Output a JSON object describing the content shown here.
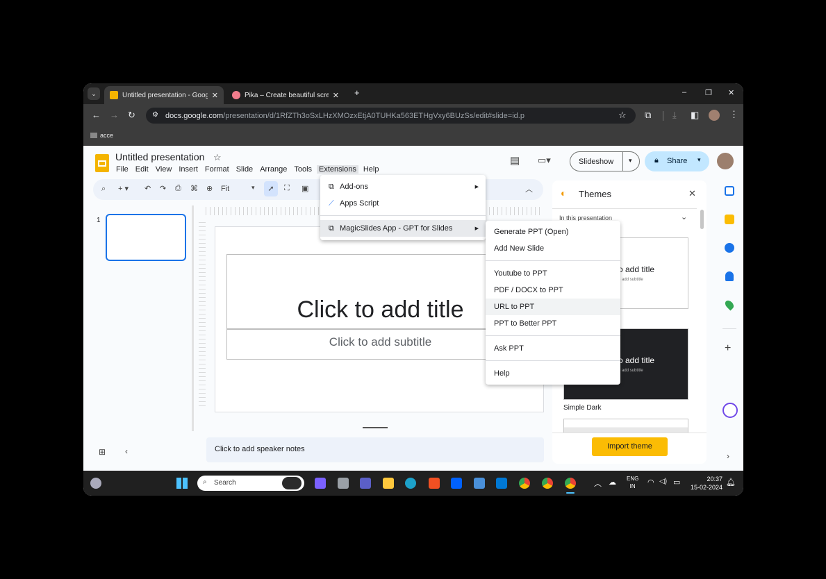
{
  "browser": {
    "tabs": [
      {
        "title": "Untitled presentation - Google",
        "close": "✕"
      },
      {
        "title": "Pika – Create beautiful screensh",
        "close": "✕"
      }
    ],
    "new_tab": "+",
    "address_host": "docs.google.com",
    "address_path": "/presentation/d/1RfZTh3oSxLHzXMOzxEtjA0TUHKa563ETHgVxy6BUzSs/edit#slide=id.p",
    "bookmark": "acce",
    "window_controls": [
      "–",
      "❐",
      "✕"
    ]
  },
  "slides": {
    "doc_title": "Untitled presentation",
    "menu": [
      "File",
      "Edit",
      "View",
      "Insert",
      "Format",
      "Slide",
      "Arrange",
      "Tools",
      "Extensions",
      "Help"
    ],
    "zoom": "Fit",
    "slideshow_label": "Slideshow",
    "share_label": "Share",
    "thumb_number": "1",
    "title_placeholder": "Click to add title",
    "subtitle_placeholder": "Click to add subtitle",
    "speaker_notes": "Click to add speaker notes"
  },
  "extensions_menu": {
    "items": [
      "Add-ons",
      "Apps Script",
      "MagicSlides App - GPT for Slides"
    ]
  },
  "magicslides_menu": {
    "items": [
      "Generate PPT (Open)",
      "Add New Slide",
      "Youtube to PPT",
      "PDF / DOCX to PPT",
      "URL to PPT",
      "PPT to Better PPT",
      "Ask PPT",
      "Help"
    ]
  },
  "themes": {
    "title": "Themes",
    "filter": "In this presentation",
    "theme1_title": "o add title",
    "theme1_sub": "o add subtitle",
    "theme2_title": "o add title",
    "theme2_sub": "o add subtitle",
    "theme2_name": "Simple Dark",
    "import_label": "Import theme"
  },
  "taskbar": {
    "search": "Search",
    "lang1": "ENG",
    "lang2": "IN",
    "time": "20:37",
    "date": "15-02-2024"
  }
}
